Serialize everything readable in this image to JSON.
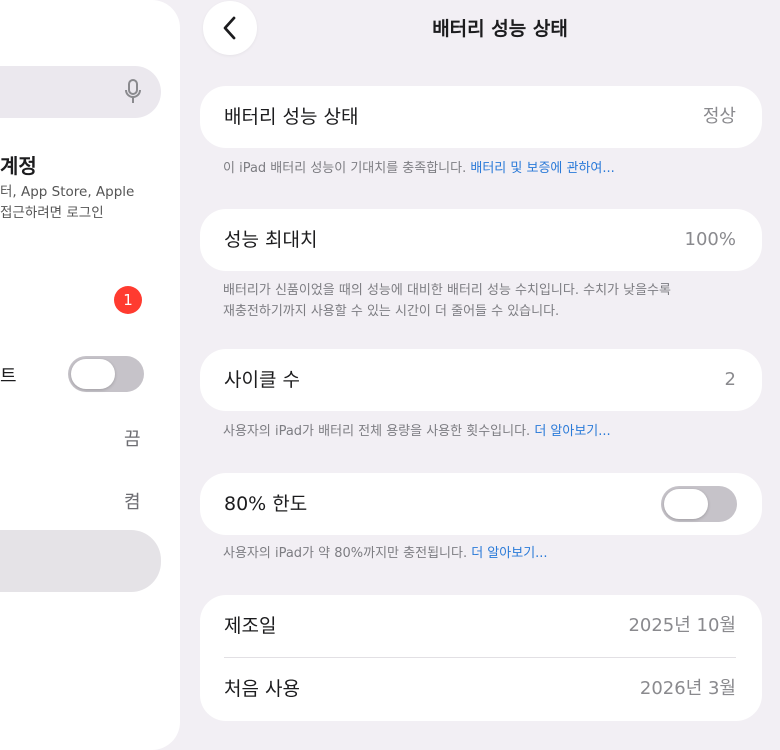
{
  "sidebar": {
    "account_title": "계정",
    "account_sub_line1": "터, App Store, Apple",
    "account_sub_line2": "접근하려면 로그인",
    "badge_count": "1",
    "toggle_item_label": "트",
    "item_off_value": "끔",
    "item_on_value": "켬"
  },
  "nav": {
    "title": "배터리 성능 상태"
  },
  "health": {
    "label": "배터리 성능 상태",
    "value": "정상",
    "note_text": "이 iPad 배터리 성능이 기대치를 충족합니다. ",
    "note_link": "배터리 및 보증에 관하여..."
  },
  "max_capacity": {
    "label": "성능 최대치",
    "value": "100%",
    "note_line1": "배터리가 신품이었을 때의 성능에 대비한 배터리 성능 수치입니다. 수치가 낮을수록",
    "note_line2": "재충전하기까지 사용할 수 있는 시간이 더 줄어들 수 있습니다."
  },
  "cycle": {
    "label": "사이클 수",
    "value": "2",
    "note_text": "사용자의 iPad가 배터리 전체 용량을 사용한 횟수입니다. ",
    "note_link": "더 알아보기..."
  },
  "limit": {
    "label": "80% 한도",
    "enabled": false,
    "note_text": "사용자의 iPad가 약 80%까지만 충전됩니다. ",
    "note_link": "더 알아보기..."
  },
  "dates": {
    "manufactured_label": "제조일",
    "manufactured_value": "2025년 10월",
    "first_use_label": "처음 사용",
    "first_use_value": "2026년 3월"
  },
  "colors": {
    "background": "#f2eff4",
    "link": "#2a7ad8",
    "badge": "#ff3b30",
    "toggle_off": "#c6c3c9"
  }
}
